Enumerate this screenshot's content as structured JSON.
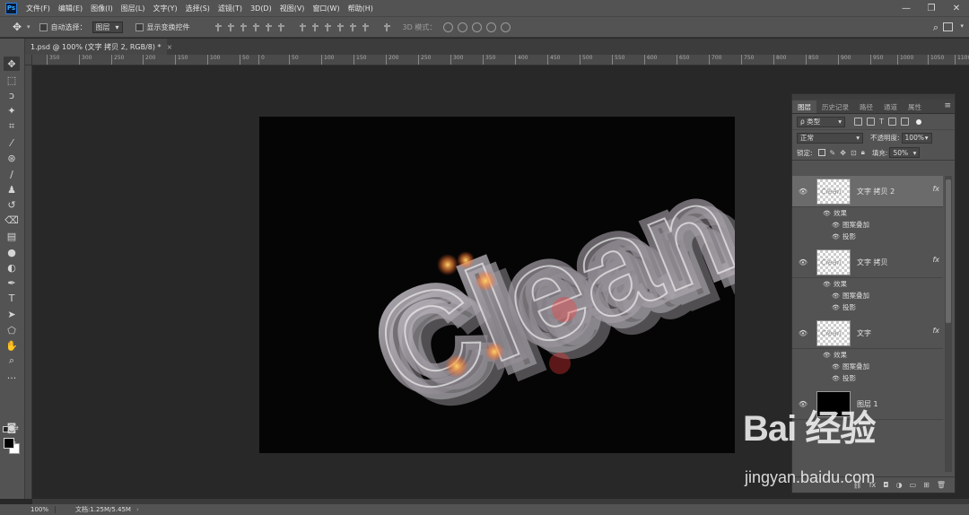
{
  "app": {
    "logo_label": "Ps",
    "menu": [
      "文件(F)",
      "编辑(E)",
      "图像(I)",
      "图层(L)",
      "文字(Y)",
      "选择(S)",
      "滤镜(T)",
      "3D(D)",
      "视图(V)",
      "窗口(W)",
      "帮助(H)"
    ],
    "window_controls": [
      "—",
      "❐",
      "✕"
    ]
  },
  "options": {
    "auto_select_label": "自动选择：",
    "auto_select_value": "图层",
    "show_transform_label": "显示变换控件",
    "mode_3d_label": "3D 模式："
  },
  "document": {
    "tab_title": "1.psd @ 100% (文字 拷贝 2, RGB/8) *",
    "tab_close": "×"
  },
  "ruler": {
    "top_ticks": [
      "350",
      "300",
      "250",
      "200",
      "150",
      "100",
      "50",
      "0",
      "50",
      "100",
      "150",
      "200",
      "250",
      "300",
      "350",
      "400",
      "450",
      "500",
      "550",
      "600",
      "650",
      "700",
      "750",
      "800",
      "850",
      "900",
      "950",
      "1000",
      "1050",
      "1100"
    ]
  },
  "status": {
    "zoom": "100%",
    "doc_size": "文档:1.25M/5.45M",
    "arrow": "›"
  },
  "layers_panel": {
    "tabs": [
      "图层",
      "历史记录",
      "路径",
      "通道",
      "属性"
    ],
    "active_tab": 0,
    "filter_kind": "ρ 类型",
    "blend_mode": "正常",
    "opacity_label": "不透明度:",
    "opacity_value": "100%",
    "lock_label": "锁定:",
    "fill_label": "填充:",
    "fill_value": "50%",
    "layers": [
      {
        "name": "文字 拷贝 2",
        "fx": "fx",
        "selected": true,
        "effects_title": "效果",
        "effects": [
          "图案叠加",
          "投影"
        ]
      },
      {
        "name": "文字 拷贝",
        "fx": "fx",
        "selected": false,
        "effects_title": "效果",
        "effects": [
          "图案叠加",
          "投影"
        ]
      },
      {
        "name": "文字",
        "fx": "fx",
        "selected": false,
        "effects_title": "效果",
        "effects": [
          "图案叠加",
          "投影"
        ]
      },
      {
        "name": "图层 1",
        "fx": "",
        "selected": false,
        "effects_title": "",
        "effects": []
      }
    ]
  },
  "canvas": {
    "artwork_text": "Clean"
  },
  "watermark": {
    "logo": "Bai 经验",
    "url": "jingyan.baidu.com"
  }
}
